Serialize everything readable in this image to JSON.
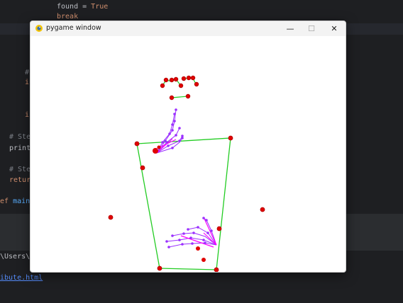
{
  "ide": {
    "code_lines": {
      "found_assign": "found = ",
      "true_kw": "True",
      "break_kw": "break",
      "comment_hash1": "#",
      "if_frag": "i",
      "if_frag2": "i",
      "comment_step1": "# Ste",
      "print_frag": "print",
      "comment_step2": "# Ste",
      "return_frag": "retur",
      "def_kw": "ef ",
      "main_fn": "main(",
      "path_frag": "\\Users\\",
      "link_text": "ibute.html"
    }
  },
  "window": {
    "title": "pygame window",
    "minimize": "—",
    "maximize": "☐",
    "close": "✕"
  },
  "colors": {
    "ide_bg": "#1e1f22",
    "keyword": "#cf8e6d",
    "landmark_point": "#e00000",
    "cup_outline": "#22cc22",
    "hand_skeleton": "#9b30ff",
    "hand_connections": "#ff00ff"
  },
  "icons": {
    "app_icon": "pygame-snake-icon",
    "minimize": "minimize-icon",
    "maximize": "maximize-icon",
    "close": "close-icon"
  }
}
